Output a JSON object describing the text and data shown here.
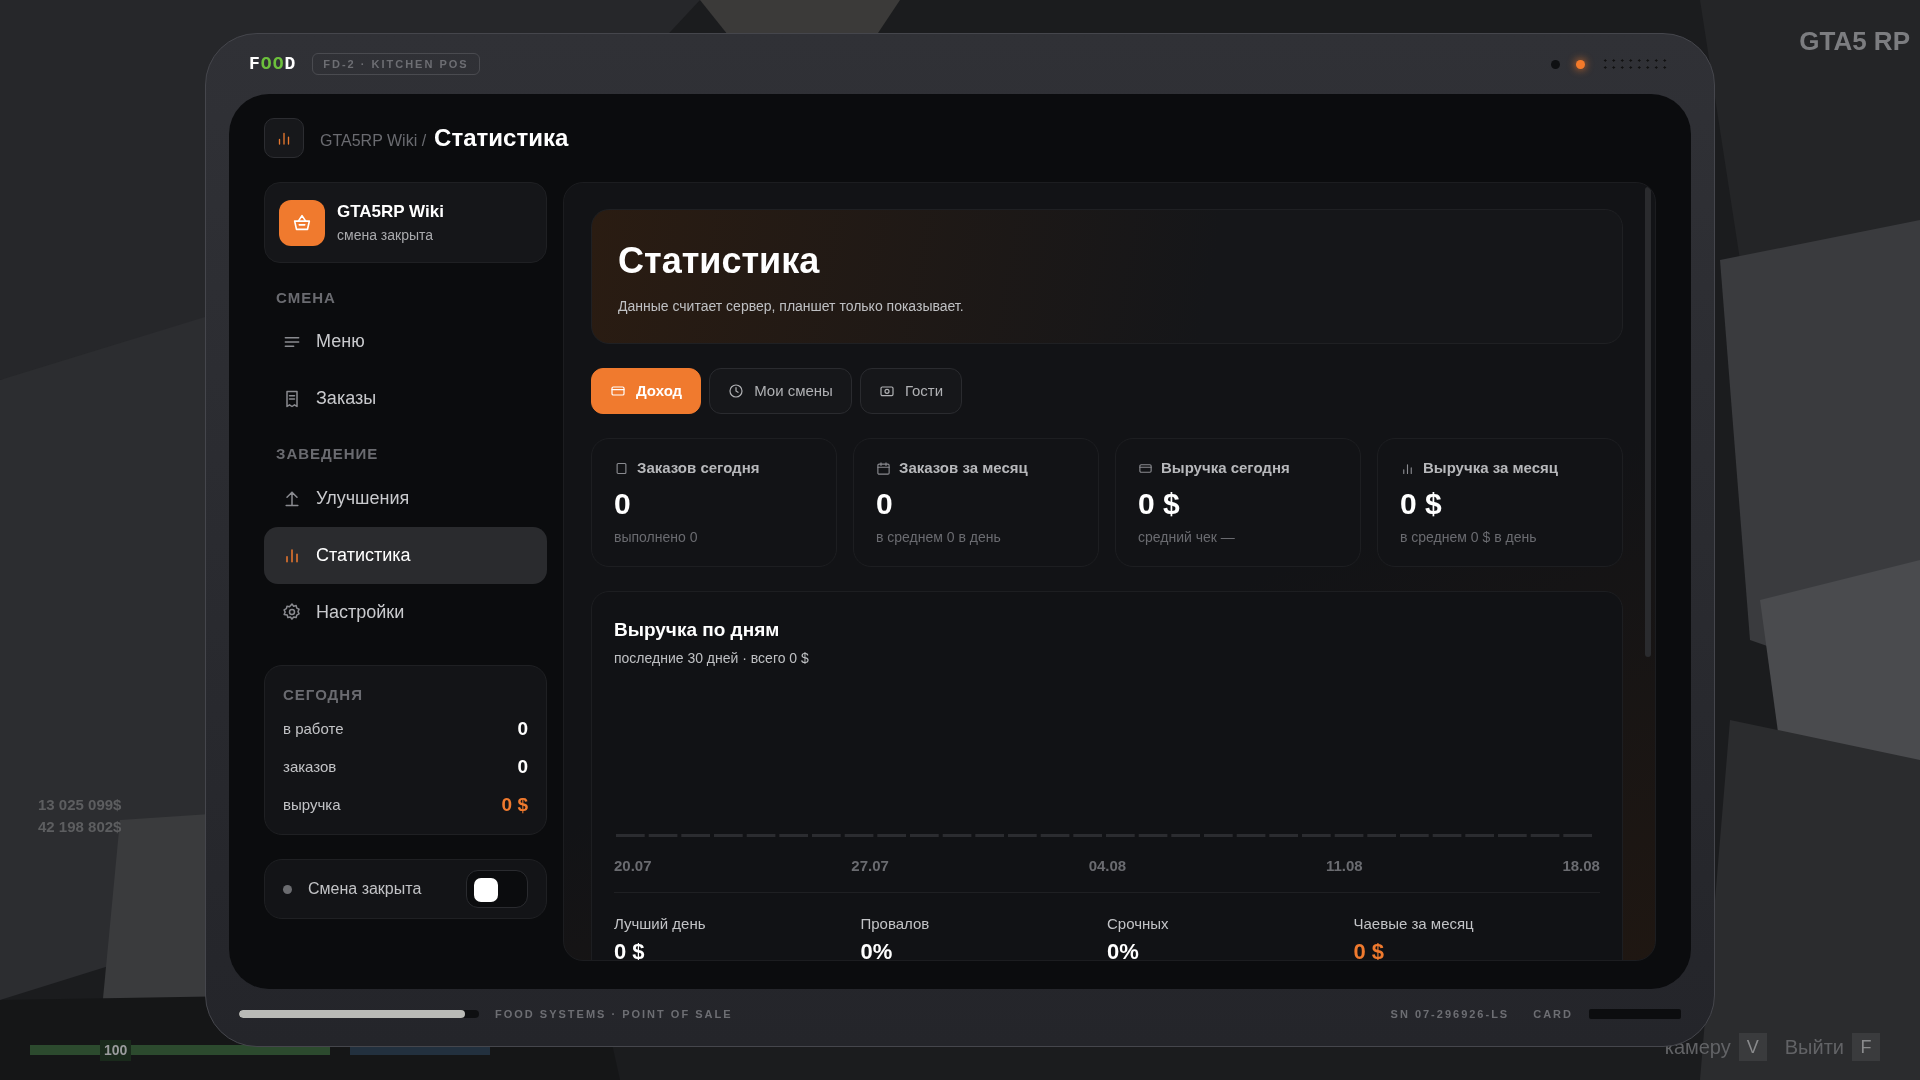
{
  "hud": {
    "logo": "GTA5 RP",
    "money": [
      "13 025 099$",
      "42 198 802$"
    ],
    "health": "100",
    "hints": [
      {
        "label": "камеру",
        "key": "V"
      },
      {
        "label": "Выйти",
        "key": "F"
      }
    ]
  },
  "device": {
    "brand": "FOOD",
    "model_badge": "FD-2 · KITCHEN POS",
    "progress": {
      "level": 0.94
    },
    "footer_text": "FOOD SYSTEMS · POINT OF SALE",
    "serial": "SN 07-296926-LS",
    "card_label": "CARD"
  },
  "breadcrumb": {
    "parent": "GTA5RP Wiki /",
    "current": "Статистика"
  },
  "profile": {
    "name": "GTA5RP Wiki",
    "status": "смена закрыта"
  },
  "sidebar": {
    "sections": [
      {
        "title": "СМЕНА",
        "items": [
          {
            "label": "Меню",
            "selected": false
          },
          {
            "label": "Заказы",
            "selected": false
          }
        ]
      },
      {
        "title": "ЗАВЕДЕНИЕ",
        "items": [
          {
            "label": "Улучшения",
            "selected": false
          },
          {
            "label": "Статистика",
            "selected": true
          },
          {
            "label": "Настройки",
            "selected": false
          }
        ]
      }
    ]
  },
  "today": {
    "title": "СЕГОДНЯ",
    "rows": [
      {
        "label": "в работе",
        "value": "0",
        "accent": false
      },
      {
        "label": "заказов",
        "value": "0",
        "accent": false
      },
      {
        "label": "выручка",
        "value": "0 $",
        "accent": true
      }
    ]
  },
  "shift_toggle": {
    "label": "Смена закрыта",
    "on": false
  },
  "header": {
    "title": "Статистика",
    "subtitle": "Данные считает сервер, планшет только показывает."
  },
  "tabs": [
    {
      "label": "Доход",
      "selected": true
    },
    {
      "label": "Мои смены",
      "selected": false
    },
    {
      "label": "Гости",
      "selected": false
    }
  ],
  "stat_cards": [
    {
      "label": "Заказов сегодня",
      "value": "0",
      "note": "выполнено 0"
    },
    {
      "label": "Заказов за месяц",
      "value": "0",
      "note": "в среднем 0 в день"
    },
    {
      "label": "Выручка сегодня",
      "value": "0 $",
      "note": "средний чек —"
    },
    {
      "label": "Выручка за месяц",
      "value": "0 $",
      "note": "в среднем 0 $ в день"
    }
  ],
  "revenue_chart": {
    "title": "Выручка по дням",
    "subtitle": "последние 30 дней · всего 0 $",
    "x_labels": [
      "20.07",
      "27.07",
      "04.08",
      "11.08",
      "18.08"
    ]
  },
  "summary": [
    {
      "label": "Лучший день",
      "value": "0 $",
      "accent": false
    },
    {
      "label": "Провалов",
      "value": "0%",
      "accent": false
    },
    {
      "label": "Срочных",
      "value": "0%",
      "accent": false
    },
    {
      "label": "Чаевые за месяц",
      "value": "0 $",
      "accent": true
    }
  ]
}
